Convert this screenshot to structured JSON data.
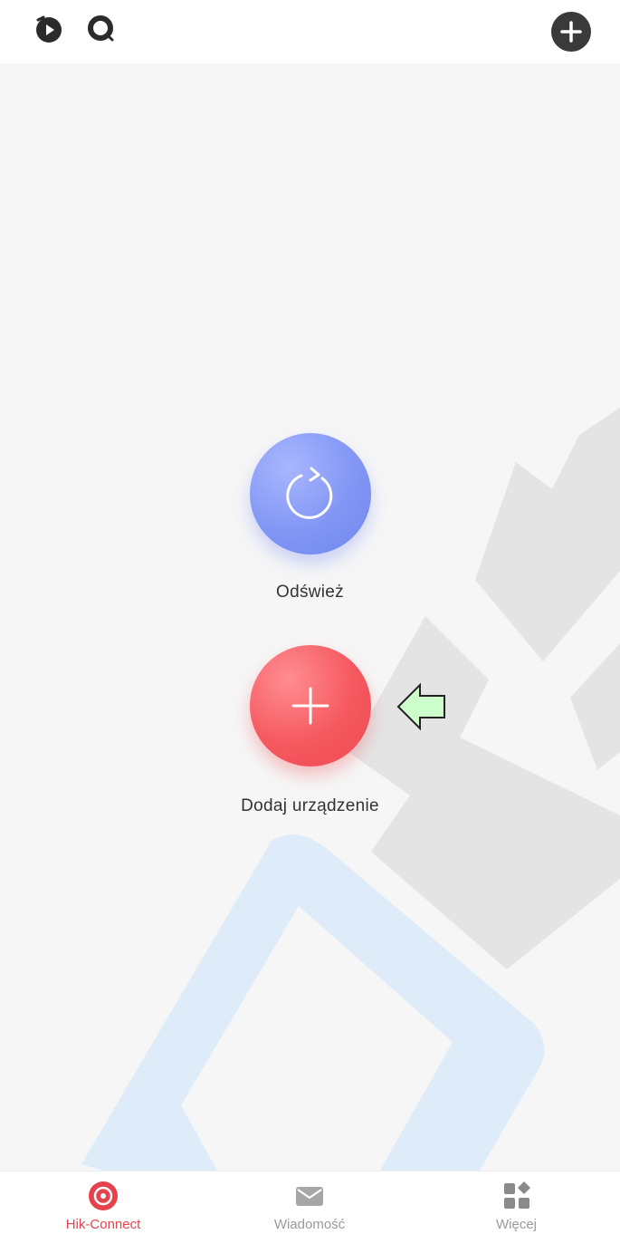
{
  "top_bar": {
    "icons": [
      "playback-icon",
      "search-icon",
      "add-device-icon"
    ]
  },
  "main": {
    "refresh_label": "Odśwież",
    "add_device_label": "Dodaj urządzenie"
  },
  "bottom_nav": {
    "items": [
      {
        "label": "Hik-Connect",
        "icon": "hik-connect-icon",
        "active": true
      },
      {
        "label": "Wiadomość",
        "icon": "mail-icon",
        "active": false
      },
      {
        "label": "Więcej",
        "icon": "more-apps-icon",
        "active": false
      }
    ]
  },
  "colors": {
    "accent_red": "#e5424b",
    "refresh_blue": "#7b8ff2",
    "annotation_green": "#ccffcc",
    "watermark_blue": "#d8e9f8",
    "watermark_grey": "#e4e4e4"
  }
}
